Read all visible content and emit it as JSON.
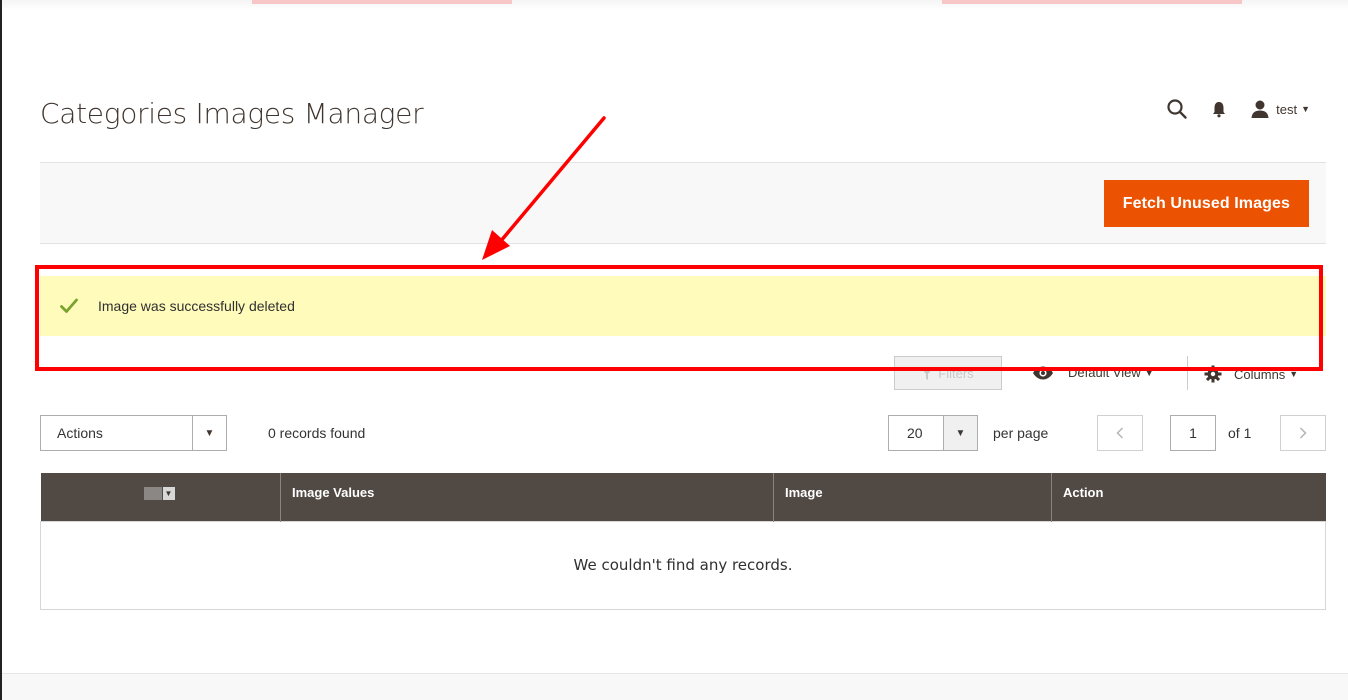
{
  "page": {
    "title": "Categories Images Manager"
  },
  "header": {
    "user_name": "test"
  },
  "page_actions": {
    "primary_button": "Fetch Unused Images"
  },
  "message": {
    "type": "success",
    "text": "Image was successfully deleted"
  },
  "toolbar": {
    "filters_label": "Filters",
    "view_label": "Default View",
    "columns_label": "Columns",
    "actions_label": "Actions",
    "records_found": "0 records found",
    "per_page_value": "20",
    "per_page_label": "per page",
    "current_page": "1",
    "page_total": "of 1"
  },
  "grid": {
    "columns": [
      "Image Values",
      "Image",
      "Action"
    ],
    "empty_text": "We couldn't find any records."
  },
  "colors": {
    "primary": "#eb5202",
    "header_bg": "#514943",
    "success_bg": "#fffbbb",
    "annotation": "#ff0000"
  },
  "icons": {
    "search": "search-icon",
    "notifications": "bell-icon",
    "user": "user-icon",
    "success": "check-icon",
    "filter": "funnel-icon",
    "view": "eye-icon",
    "columns": "gear-icon"
  }
}
